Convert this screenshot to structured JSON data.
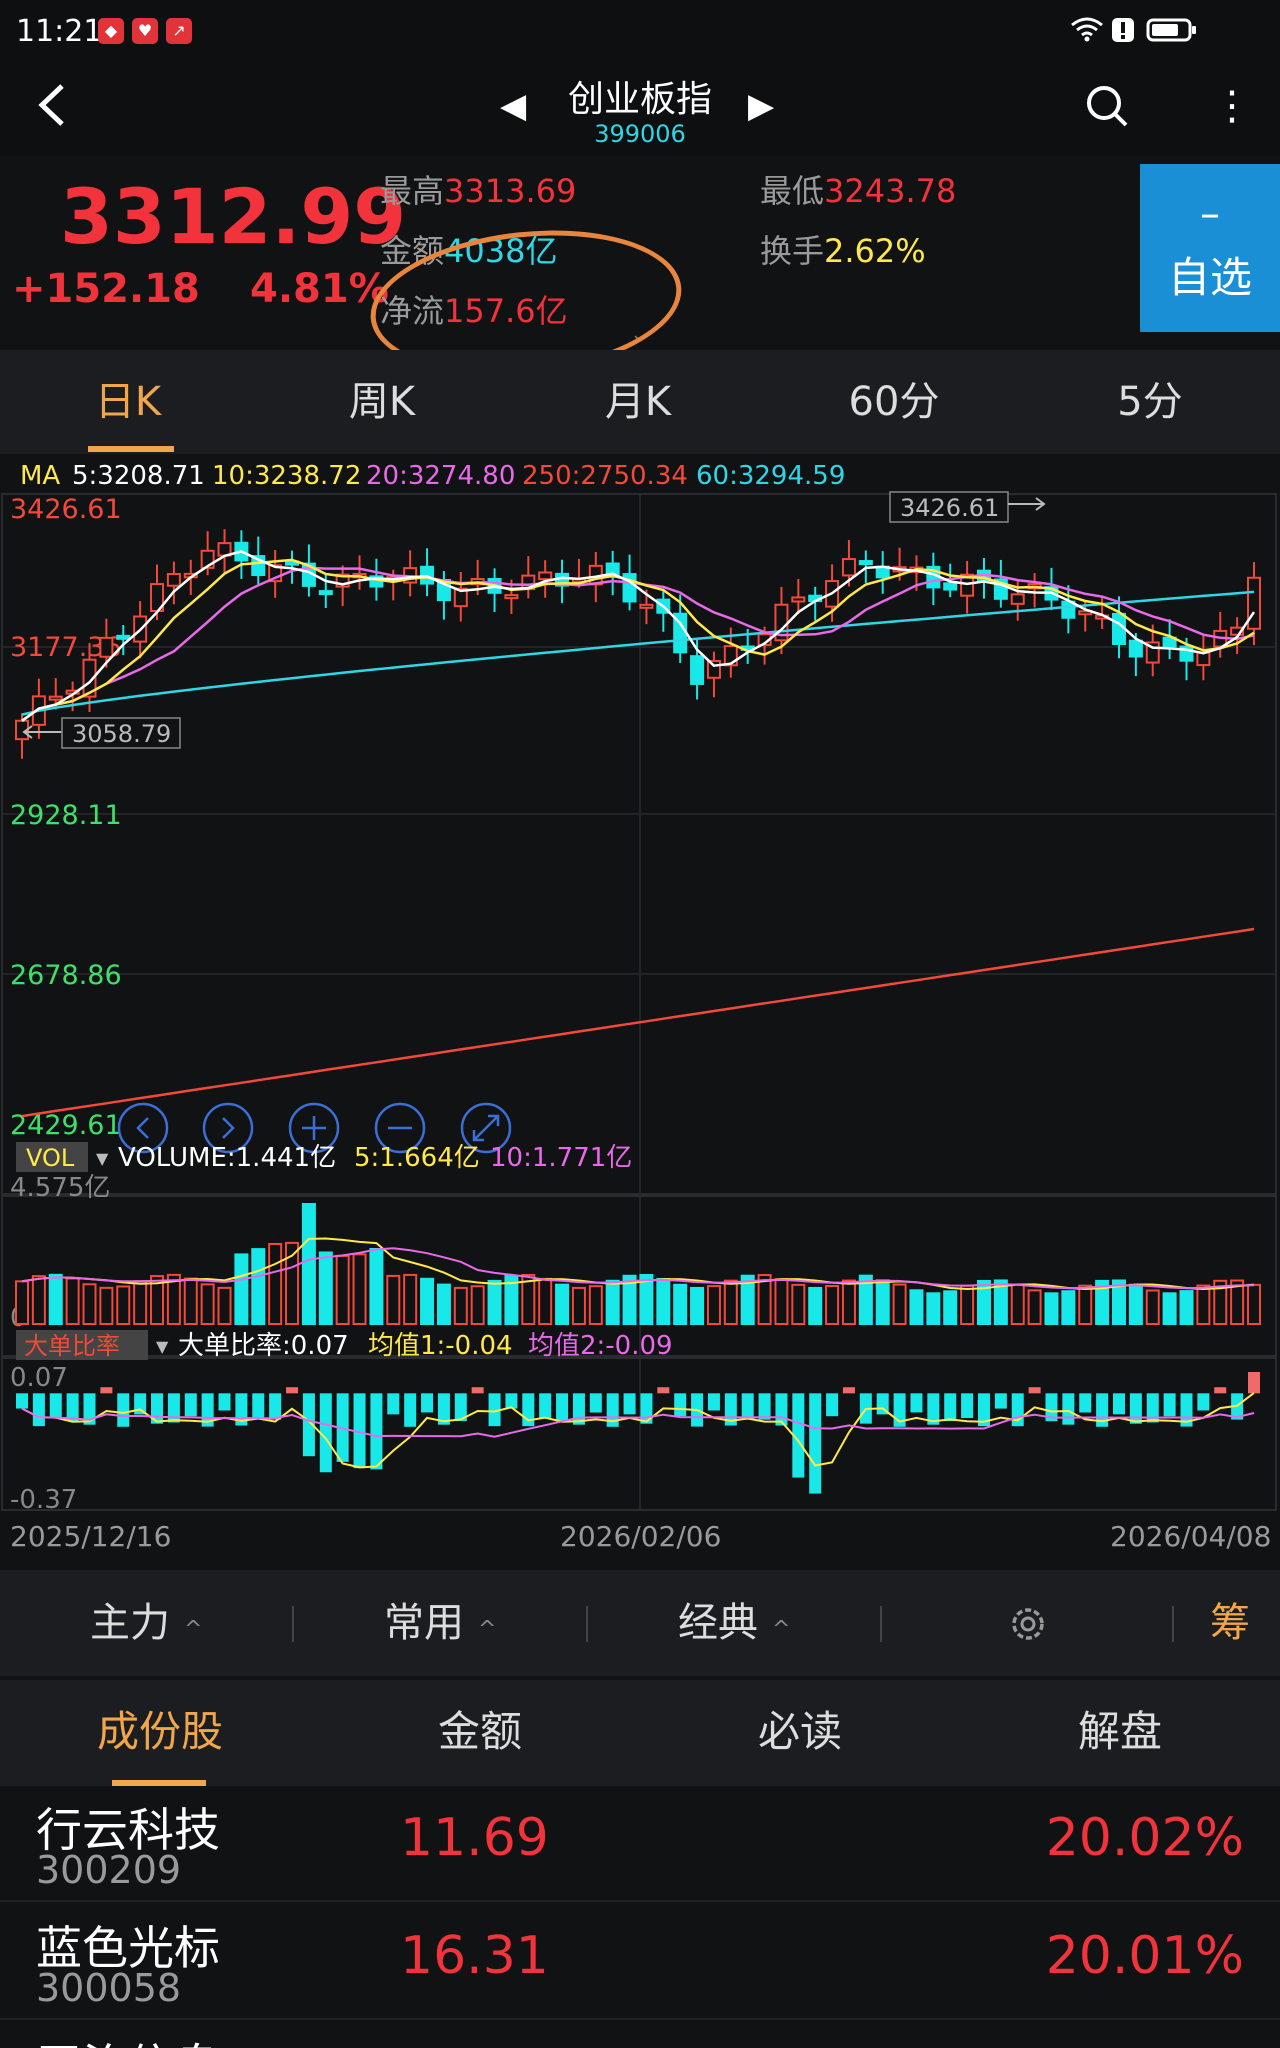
{
  "status_bar": {
    "time": "11:21"
  },
  "header": {
    "back_icon": "chevron-left-icon",
    "title": "创业板指",
    "code": "399006"
  },
  "quote": {
    "price": "3312.99",
    "change": "+152.18",
    "change_pct": "4.81%",
    "high_label": "最高",
    "high": "3313.69",
    "low_label": "最低",
    "low": "3243.78",
    "amount_label": "金额",
    "amount": "4038亿",
    "turnover_label": "换手",
    "turnover": "2.62%",
    "netflow_label": "净流",
    "netflow": "157.6亿",
    "watch_minus": "–",
    "watch_label": "自选"
  },
  "period_tabs": [
    "日K",
    "周K",
    "月K",
    "60分",
    "5分"
  ],
  "chart": {
    "ma_title": "MA",
    "ma": [
      {
        "label": "5:3208.71",
        "color": "#ffffff"
      },
      {
        "label": "10:3238.72",
        "color": "#ffe94a"
      },
      {
        "label": "20:3274.80",
        "color": "#e86ae8"
      },
      {
        "label": "250:2750.34",
        "color": "#f2493b"
      },
      {
        "label": "60:3294.59",
        "color": "#2fd7e6"
      }
    ],
    "y_labels": [
      "3426.61",
      "3177.36",
      "2928.11",
      "2678.86",
      "2429.61"
    ],
    "max_marker": "3426.61",
    "min_marker": "3058.79",
    "vol_tag": "VOL",
    "vol_title": "VOLUME:1.441亿",
    "vol_ma5": "5:1.664亿",
    "vol_ma10": "10:1.771亿",
    "vol_max": "4.575亿",
    "vol_min": "0",
    "ratio_tag": "大单比率",
    "ratio_title": "大单比率:0.07",
    "ratio_avg1": "均值1:-0.04",
    "ratio_avg2": "均值2:-0.09",
    "ratio_max": "0.07",
    "ratio_min": "-0.37",
    "dates": [
      "2025/12/16",
      "2026/02/06",
      "2026/04/08"
    ]
  },
  "chart_data": {
    "type": "candlestick",
    "ylim": [
      2429.61,
      3426.61
    ],
    "x_range": [
      "2025/12/16",
      "2026/04/08"
    ],
    "ma250_range": [
      2429.61,
      2750.34
    ],
    "max": 3426.61,
    "min": 3058.79,
    "last_close": 3312.99,
    "volume_ylim": [
      0,
      4.575
    ],
    "ratio_ylim": [
      -0.37,
      0.07
    ],
    "last_ratio": 0.07
  },
  "toolbar": {
    "items": [
      "主力",
      "常用",
      "经典"
    ],
    "gear_icon": "gear-icon",
    "chip": "筹"
  },
  "list_tabs": [
    "成份股",
    "金额",
    "必读",
    "解盘"
  ],
  "stocks": [
    {
      "name": "行云科技",
      "code": "300209",
      "price": "11.69",
      "pct": "20.02%"
    },
    {
      "name": "蓝色光标",
      "code": "300058",
      "price": "16.31",
      "pct": "20.01%"
    },
    {
      "name": "平治信息",
      "code": "",
      "price": "",
      "pct": ""
    }
  ]
}
